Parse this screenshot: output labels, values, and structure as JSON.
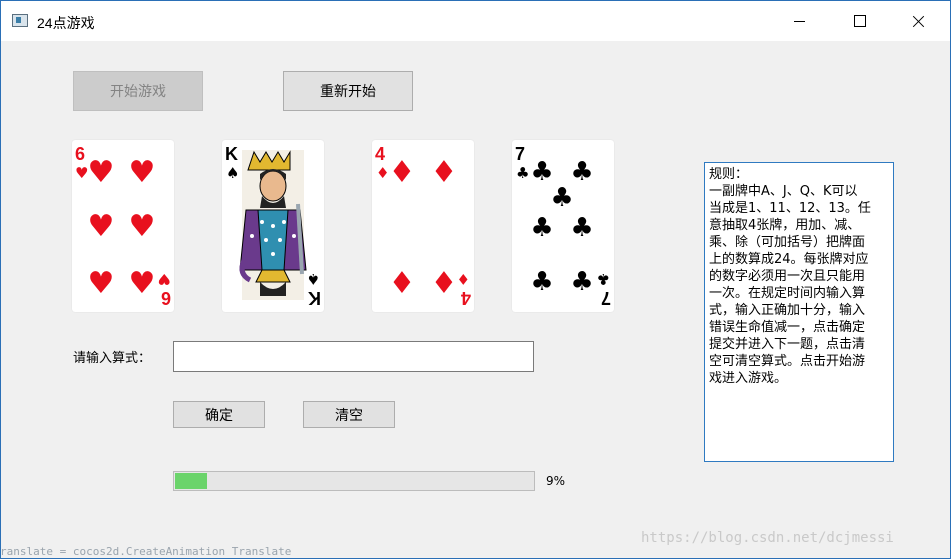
{
  "window": {
    "title": "24点游戏"
  },
  "buttons": {
    "start": "开始游戏",
    "restart": "重新开始",
    "ok": "确定",
    "clear": "清空"
  },
  "cards": [
    {
      "rank": "6",
      "suit": "hearts",
      "symbol": "♥",
      "color": "#e8101e"
    },
    {
      "rank": "K",
      "suit": "spades",
      "symbol": "♠",
      "color": "#000000"
    },
    {
      "rank": "4",
      "suit": "diamonds",
      "symbol": "♦",
      "color": "#e8101e"
    },
    {
      "rank": "7",
      "suit": "clubs",
      "symbol": "♣",
      "color": "#000000"
    }
  ],
  "form": {
    "label": "请输入算式：",
    "value": "",
    "placeholder": ""
  },
  "progress": {
    "percent": 9,
    "text": "9%",
    "color": "#6bd46b"
  },
  "rules": {
    "lines": [
      "规则：",
      "一副牌中A、J、Q、K可以",
      "当成是1、11、12、13。任",
      "意抽取4张牌，用加、减、",
      "乘、除（可加括号）把牌面",
      "上的数算成24。每张牌对应",
      "的数字必须用一次且只能用",
      "一次。在规定时间内输入算",
      "式，输入正确加十分，输入",
      "错误生命值减一，点击确定",
      "提交并进入下一题，点击清",
      "空可清空算式。点击开始游",
      "戏进入游戏。"
    ]
  },
  "watermark": "https://blog.csdn.net/dcjmessi",
  "bottom_strip": "ranslate = cocos2d.CreateAnimation Translate"
}
